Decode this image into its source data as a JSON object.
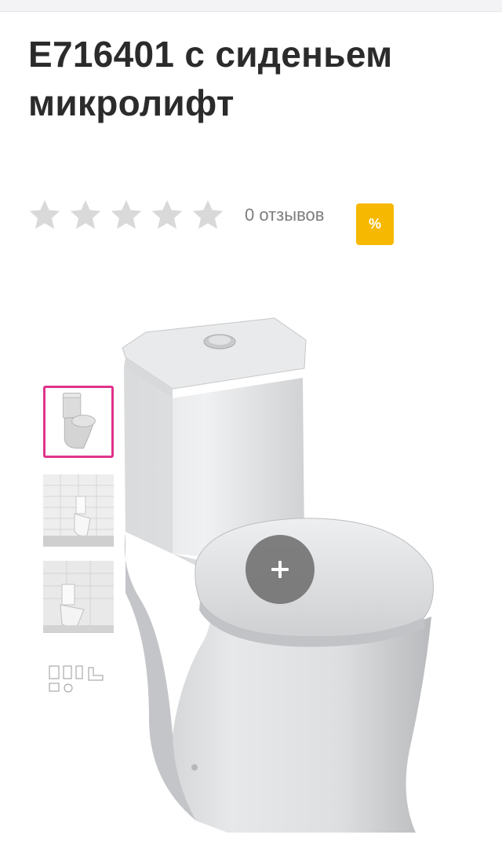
{
  "product": {
    "title": "E716401 с сиденьем микролифт"
  },
  "rating": {
    "value": 0,
    "max": 5,
    "reviews_text": "0 отзывов",
    "star_color": "#d9d9d9"
  },
  "badge": {
    "label": "%",
    "color": "#f6b800"
  },
  "gallery": {
    "selected_index": 0,
    "thumbnail_count": 4,
    "highlight_color": "#e0338b",
    "zoom_icon": "plus-icon"
  }
}
